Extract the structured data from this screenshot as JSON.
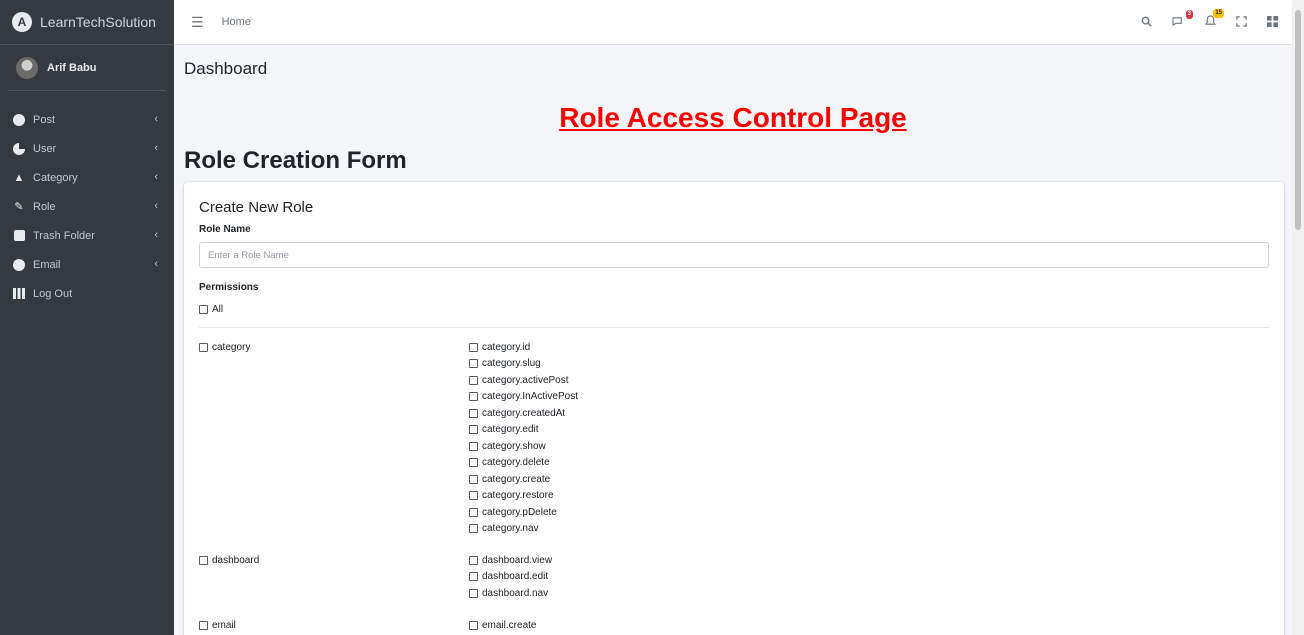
{
  "sidebar": {
    "brand": "LearnTechSolution",
    "user": "Arif Babu",
    "items": [
      {
        "label": "Post",
        "icon": "tachometer-icon"
      },
      {
        "label": "User",
        "icon": "chart-pie-icon"
      },
      {
        "label": "Category",
        "icon": "tree-icon"
      },
      {
        "label": "Role",
        "icon": "edit-icon"
      },
      {
        "label": "Trash Folder",
        "icon": "trash-icon"
      },
      {
        "label": "Email",
        "icon": "tachometer-icon"
      },
      {
        "label": "Log Out",
        "icon": "th-icon"
      }
    ]
  },
  "topbar": {
    "home": "Home",
    "messages_badge": "3",
    "notifications_badge": "15"
  },
  "content": {
    "breadcrumb_title": "Dashboard",
    "page_heading": "Role Access Control Page",
    "form_heading": "Role Creation Form"
  },
  "form": {
    "card_title": "Create New Role",
    "role_name_label": "Role Name",
    "role_name_placeholder": "Enter a Role Name",
    "role_name_value": "",
    "permissions_label": "Permissions",
    "all_label": "All",
    "groups": [
      {
        "name": "category",
        "permissions": [
          "category.id",
          "category.slug",
          "category.activePost",
          "category.InActivePost",
          "category.createdAt",
          "category.edit",
          "category.show",
          "category.delete",
          "category.create",
          "category.restore",
          "category.pDelete",
          "category.nav"
        ]
      },
      {
        "name": "dashboard",
        "permissions": [
          "dashboard.view",
          "dashboard.edit",
          "dashboard.nav"
        ]
      },
      {
        "name": "email",
        "permissions": [
          "email.create"
        ]
      }
    ]
  },
  "colors": {
    "sidebar_bg": "#343a40",
    "heading_red": "#ff0000",
    "content_bg": "#f4f6f9"
  }
}
